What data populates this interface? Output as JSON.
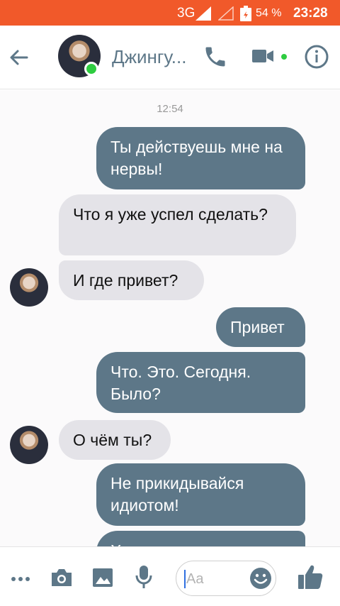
{
  "status_bar": {
    "network": "3G",
    "battery_percent": "54 %",
    "time": "23:28"
  },
  "header": {
    "contact_name": "Джингу...",
    "back_icon": "arrow-left-icon",
    "call_icon": "phone-icon",
    "video_icon": "video-camera-icon",
    "info_icon": "info-icon"
  },
  "conversation": {
    "timestamp": "12:54",
    "messages": [
      {
        "direction": "out",
        "text": "Ты действуешь мне на нервы!"
      },
      {
        "direction": "in",
        "text": "Что я уже успел сделать?"
      },
      {
        "direction": "in",
        "text": "И где привет?"
      },
      {
        "direction": "out",
        "text": "Привет"
      },
      {
        "direction": "out",
        "text": "Что. Это. Сегодня. Было?"
      },
      {
        "direction": "in",
        "text": "О чём ты?"
      },
      {
        "direction": "out",
        "text": "Не прикидывайся идиотом!"
      },
      {
        "direction": "out",
        "text": "Хочешь сказать, ничего"
      }
    ]
  },
  "composer": {
    "placeholder": "Aa"
  },
  "colors": {
    "status_bar": "#f1592a",
    "accent": "#5d7788",
    "incoming_bubble": "#e4e3e8",
    "online": "#2ecc40"
  }
}
